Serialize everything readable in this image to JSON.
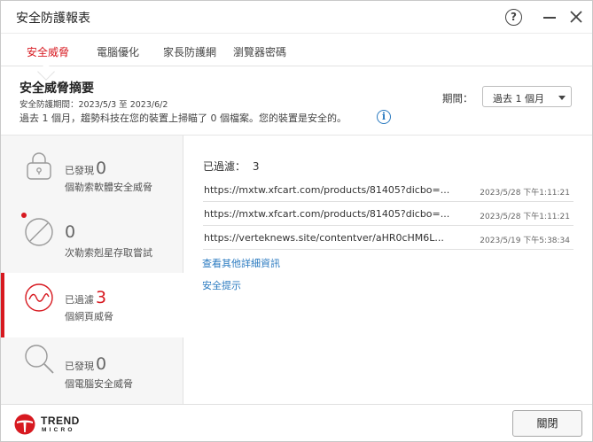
{
  "window": {
    "title": "安全防護報表"
  },
  "tabs": [
    {
      "label": "安全威脅",
      "active": true
    },
    {
      "label": "電腦優化",
      "active": false
    },
    {
      "label": "家長防護網",
      "active": false
    },
    {
      "label": "瀏覽器密碼",
      "active": false
    }
  ],
  "summary": {
    "title": "安全威脅摘要",
    "period_range": "安全防護期間：2023/5/3 至 2023/6/2",
    "description": "過去 1 個月，趨勢科技在您的裝置上掃瞄了 0 個檔案。您的裝置是安全的。",
    "period_label": "期間：",
    "period_value": "過去 1 個月"
  },
  "sidebar": {
    "items": [
      {
        "prefix": "已發現",
        "count": "0",
        "subtitle": "個勒索軟體安全威脅",
        "icon": "lock-icon",
        "active": false
      },
      {
        "prefix": "",
        "count": "0",
        "subtitle": "次勒索剋星存取嘗試",
        "icon": "block-icon",
        "active": false
      },
      {
        "prefix": "已過濾",
        "count": "3",
        "subtitle": "個網頁威脅",
        "icon": "web-threat-icon",
        "active": true
      },
      {
        "prefix": "已發現",
        "count": "0",
        "subtitle": "個電腦安全威脅",
        "icon": "magnifier-icon",
        "active": false
      }
    ]
  },
  "detail": {
    "filtered_label": "已過濾：",
    "filtered_count": "3",
    "rows": [
      {
        "url": "https://mxtw.xfcart.com/products/81405?dicbo=...",
        "time": "2023/5/28 下午1:11:21"
      },
      {
        "url": "https://mxtw.xfcart.com/products/81405?dicbo=...",
        "time": "2023/5/28 下午1:11:21"
      },
      {
        "url": "https://verteknews.site/contentver/aHR0cHM6L...",
        "time": "2023/5/19 下午5:38:34"
      }
    ],
    "more_link": "查看其他詳細資訊",
    "tips_link": "安全提示"
  },
  "footer": {
    "logo_top": "TREND",
    "logo_bottom": "MICRO",
    "close_label": "關閉"
  },
  "colors": {
    "accent": "#d71920",
    "link": "#2a7ac0"
  }
}
